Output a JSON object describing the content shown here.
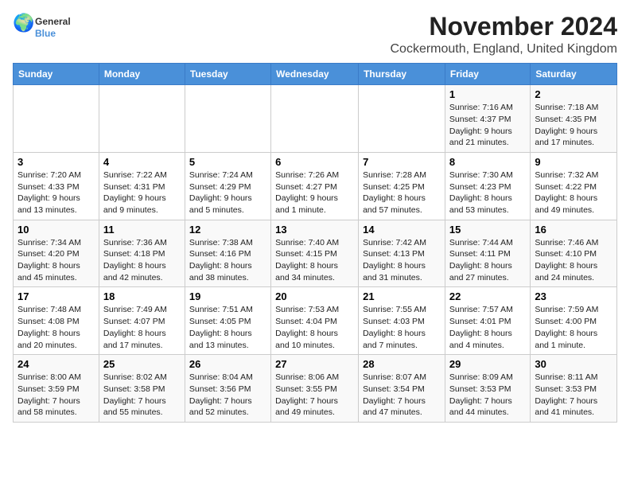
{
  "logo": {
    "text_general": "General",
    "text_blue": "Blue"
  },
  "title": "November 2024",
  "subtitle": "Cockermouth, England, United Kingdom",
  "days_of_week": [
    "Sunday",
    "Monday",
    "Tuesday",
    "Wednesday",
    "Thursday",
    "Friday",
    "Saturday"
  ],
  "weeks": [
    [
      {
        "day": "",
        "info": ""
      },
      {
        "day": "",
        "info": ""
      },
      {
        "day": "",
        "info": ""
      },
      {
        "day": "",
        "info": ""
      },
      {
        "day": "",
        "info": ""
      },
      {
        "day": "1",
        "info": "Sunrise: 7:16 AM\nSunset: 4:37 PM\nDaylight: 9 hours and 21 minutes."
      },
      {
        "day": "2",
        "info": "Sunrise: 7:18 AM\nSunset: 4:35 PM\nDaylight: 9 hours and 17 minutes."
      }
    ],
    [
      {
        "day": "3",
        "info": "Sunrise: 7:20 AM\nSunset: 4:33 PM\nDaylight: 9 hours and 13 minutes."
      },
      {
        "day": "4",
        "info": "Sunrise: 7:22 AM\nSunset: 4:31 PM\nDaylight: 9 hours and 9 minutes."
      },
      {
        "day": "5",
        "info": "Sunrise: 7:24 AM\nSunset: 4:29 PM\nDaylight: 9 hours and 5 minutes."
      },
      {
        "day": "6",
        "info": "Sunrise: 7:26 AM\nSunset: 4:27 PM\nDaylight: 9 hours and 1 minute."
      },
      {
        "day": "7",
        "info": "Sunrise: 7:28 AM\nSunset: 4:25 PM\nDaylight: 8 hours and 57 minutes."
      },
      {
        "day": "8",
        "info": "Sunrise: 7:30 AM\nSunset: 4:23 PM\nDaylight: 8 hours and 53 minutes."
      },
      {
        "day": "9",
        "info": "Sunrise: 7:32 AM\nSunset: 4:22 PM\nDaylight: 8 hours and 49 minutes."
      }
    ],
    [
      {
        "day": "10",
        "info": "Sunrise: 7:34 AM\nSunset: 4:20 PM\nDaylight: 8 hours and 45 minutes."
      },
      {
        "day": "11",
        "info": "Sunrise: 7:36 AM\nSunset: 4:18 PM\nDaylight: 8 hours and 42 minutes."
      },
      {
        "day": "12",
        "info": "Sunrise: 7:38 AM\nSunset: 4:16 PM\nDaylight: 8 hours and 38 minutes."
      },
      {
        "day": "13",
        "info": "Sunrise: 7:40 AM\nSunset: 4:15 PM\nDaylight: 8 hours and 34 minutes."
      },
      {
        "day": "14",
        "info": "Sunrise: 7:42 AM\nSunset: 4:13 PM\nDaylight: 8 hours and 31 minutes."
      },
      {
        "day": "15",
        "info": "Sunrise: 7:44 AM\nSunset: 4:11 PM\nDaylight: 8 hours and 27 minutes."
      },
      {
        "day": "16",
        "info": "Sunrise: 7:46 AM\nSunset: 4:10 PM\nDaylight: 8 hours and 24 minutes."
      }
    ],
    [
      {
        "day": "17",
        "info": "Sunrise: 7:48 AM\nSunset: 4:08 PM\nDaylight: 8 hours and 20 minutes."
      },
      {
        "day": "18",
        "info": "Sunrise: 7:49 AM\nSunset: 4:07 PM\nDaylight: 8 hours and 17 minutes."
      },
      {
        "day": "19",
        "info": "Sunrise: 7:51 AM\nSunset: 4:05 PM\nDaylight: 8 hours and 13 minutes."
      },
      {
        "day": "20",
        "info": "Sunrise: 7:53 AM\nSunset: 4:04 PM\nDaylight: 8 hours and 10 minutes."
      },
      {
        "day": "21",
        "info": "Sunrise: 7:55 AM\nSunset: 4:03 PM\nDaylight: 8 hours and 7 minutes."
      },
      {
        "day": "22",
        "info": "Sunrise: 7:57 AM\nSunset: 4:01 PM\nDaylight: 8 hours and 4 minutes."
      },
      {
        "day": "23",
        "info": "Sunrise: 7:59 AM\nSunset: 4:00 PM\nDaylight: 8 hours and 1 minute."
      }
    ],
    [
      {
        "day": "24",
        "info": "Sunrise: 8:00 AM\nSunset: 3:59 PM\nDaylight: 7 hours and 58 minutes."
      },
      {
        "day": "25",
        "info": "Sunrise: 8:02 AM\nSunset: 3:58 PM\nDaylight: 7 hours and 55 minutes."
      },
      {
        "day": "26",
        "info": "Sunrise: 8:04 AM\nSunset: 3:56 PM\nDaylight: 7 hours and 52 minutes."
      },
      {
        "day": "27",
        "info": "Sunrise: 8:06 AM\nSunset: 3:55 PM\nDaylight: 7 hours and 49 minutes."
      },
      {
        "day": "28",
        "info": "Sunrise: 8:07 AM\nSunset: 3:54 PM\nDaylight: 7 hours and 47 minutes."
      },
      {
        "day": "29",
        "info": "Sunrise: 8:09 AM\nSunset: 3:53 PM\nDaylight: 7 hours and 44 minutes."
      },
      {
        "day": "30",
        "info": "Sunrise: 8:11 AM\nSunset: 3:53 PM\nDaylight: 7 hours and 41 minutes."
      }
    ]
  ]
}
